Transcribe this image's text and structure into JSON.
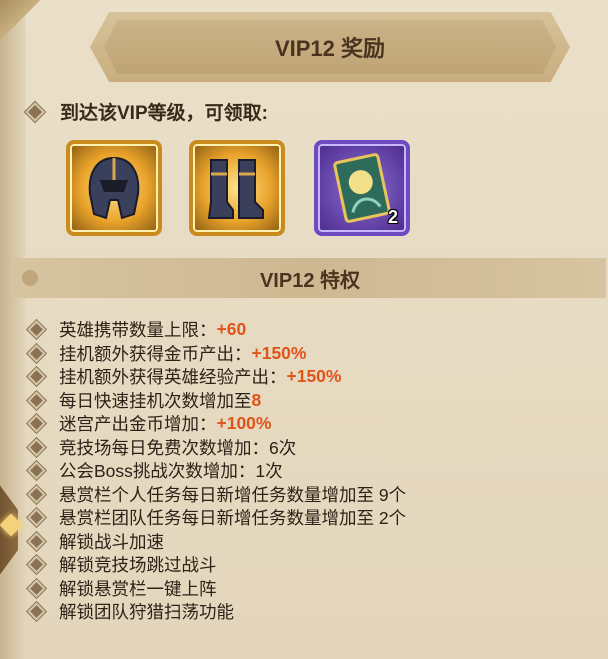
{
  "title": "VIP12 奖励",
  "reach_text": "到达该VIP等级，可领取:",
  "rewards": [
    {
      "name": "helmet-item",
      "count": ""
    },
    {
      "name": "boots-item",
      "count": ""
    },
    {
      "name": "card-item",
      "count": "2"
    }
  ],
  "privileges_title": "VIP12 特权",
  "privileges": [
    {
      "label": "英雄携带数量上限：",
      "value": "+60"
    },
    {
      "label": "挂机额外获得金币产出：",
      "value": "+150%"
    },
    {
      "label": "挂机额外获得英雄经验产出：",
      "value": "+150%"
    },
    {
      "label": "每日快速挂机次数增加至 ",
      "value": "8"
    },
    {
      "label": "迷宫产出金币增加：",
      "value": "+100%"
    },
    {
      "label": "竞技场每日免费次数增加：6次",
      "value": ""
    },
    {
      "label": "公会Boss挑战次数增加：1次",
      "value": ""
    },
    {
      "label": "悬赏栏个人任务每日新增任务数量增加至 9个",
      "value": ""
    },
    {
      "label": "悬赏栏团队任务每日新增任务数量增加至 2个",
      "value": ""
    },
    {
      "label": "解锁战斗加速",
      "value": ""
    },
    {
      "label": "解锁竞技场跳过战斗",
      "value": ""
    },
    {
      "label": "解锁悬赏栏一键上阵",
      "value": ""
    },
    {
      "label": "解锁团队狩猎扫荡功能",
      "value": ""
    }
  ],
  "colors": {
    "accent_value": "#e0541a",
    "gold_frame": "#c98a1e",
    "purple_frame": "#6e4bc0"
  }
}
